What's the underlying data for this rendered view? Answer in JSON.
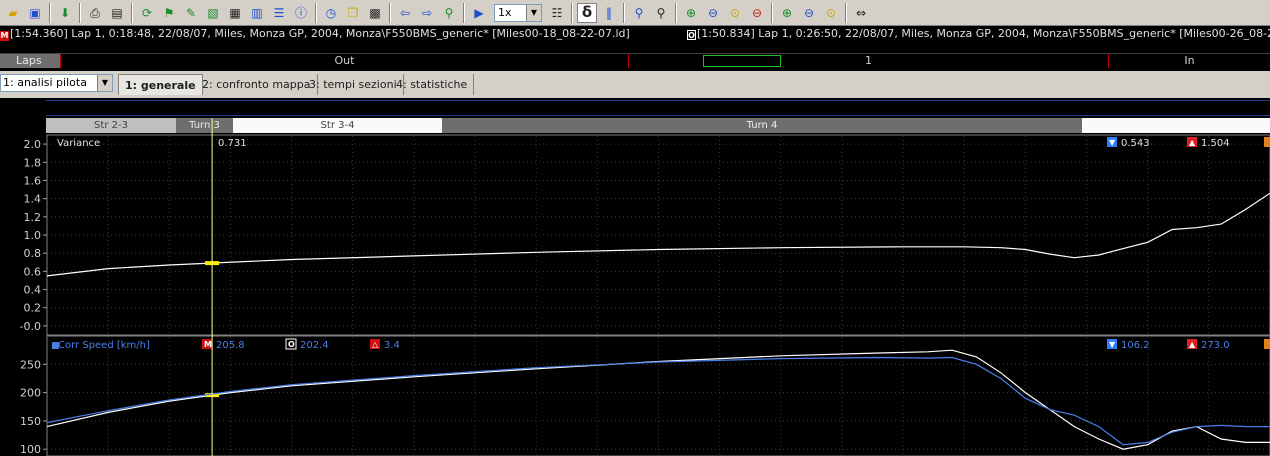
{
  "toolbar": {
    "icons": [
      "open-folder-icon",
      "save-icon",
      "download-arrow-icon",
      "print-icon",
      "print-preview-icon",
      "refresh-icon",
      "checkered-flag-icon",
      "edit-icon",
      "export-icon",
      "film-icon",
      "calculator-icon",
      "list-icon",
      "info-icon",
      "clock-icon",
      "windows-icon",
      "grid-icon",
      "back-arrow-icon",
      "forward-arrow-icon",
      "marker-icon",
      "play-icon"
    ],
    "speed_value": "1x",
    "delta_label": "δ",
    "zoom_icons": [
      "magnify-icon",
      "magnify-dark-icon",
      "zoom-in-icon",
      "zoom-out-icon",
      "zoom-yellow-icon",
      "zoom-red-icon",
      "zoom-in-plus-icon",
      "zoom-out-minus-icon",
      "zoom-fit-icon",
      "sync-cursor-icon"
    ]
  },
  "laps": {
    "lap_a": {
      "marker": "M",
      "text": "[1:54.360] Lap 1, 0:18:48, 22/08/07, Miles, Monza GP, 2004, Monza\\F550BMS_generic* [Miles00-18_08-22-07.ld]"
    },
    "lap_b": {
      "marker": "O",
      "text": "[1:50.834] Lap 1, 0:26:50, 22/08/07, Miles, Monza GP, 2004, Monza\\F550BMS_generic* [Miles00-26_08-22-07.ld]"
    }
  },
  "lapsbar": {
    "label": "Laps",
    "segments": [
      {
        "label": "Out"
      },
      {
        "label": "1"
      },
      {
        "label": "In"
      }
    ]
  },
  "workbook": {
    "selected": "1: analisi pilota"
  },
  "tabs": [
    {
      "label": "1: generale",
      "active": true
    },
    {
      "label": "2: confronto mappa",
      "active": false
    },
    {
      "label": "3: tempi sezioni",
      "active": false
    },
    {
      "label": "4: statistiche",
      "active": false
    }
  ],
  "sections": [
    {
      "label": "Str 2-3"
    },
    {
      "label": "Turn 3"
    },
    {
      "label": "Str 3-4"
    },
    {
      "label": "Turn 4"
    }
  ],
  "chart_data": [
    {
      "type": "line",
      "channel": "Variance",
      "cursor_value": "0.731",
      "min_label": "0.543",
      "max_label": "1.504",
      "ylim": [
        -0.1,
        2.1
      ],
      "yticks": [
        "2.0",
        "1.8",
        "1.6",
        "1.4",
        "1.2",
        "1.0",
        "0.8",
        "0.6",
        "0.4",
        "0.2",
        "-0.0"
      ],
      "ytick_values": [
        2.0,
        1.8,
        1.6,
        1.4,
        1.2,
        1.0,
        0.8,
        0.6,
        0.4,
        0.2,
        0.0
      ],
      "x": [
        0,
        0.05,
        0.1,
        0.2,
        0.3,
        0.4,
        0.5,
        0.6,
        0.7,
        0.75,
        0.78,
        0.8,
        0.82,
        0.84,
        0.86,
        0.88,
        0.9,
        0.92,
        0.94,
        0.96,
        0.98,
        1.0
      ],
      "series": [
        {
          "color": "#ffffff",
          "values": [
            0.55,
            0.63,
            0.67,
            0.73,
            0.77,
            0.81,
            0.84,
            0.86,
            0.87,
            0.87,
            0.86,
            0.84,
            0.79,
            0.75,
            0.78,
            0.85,
            0.92,
            1.06,
            1.08,
            1.12,
            1.28,
            1.46
          ]
        }
      ],
      "grid": true,
      "cursor_x": 0.135
    },
    {
      "type": "line",
      "channel": "Corr Speed [km/h]",
      "marker_m_value": "205.8",
      "marker_o_value": "202.4",
      "delta_value": "3.4",
      "min_label": "106.2",
      "max_label": "273.0",
      "ylim": [
        88,
        300
      ],
      "yticks": [
        "250",
        "200",
        "150",
        "100"
      ],
      "ytick_values": [
        250,
        200,
        150,
        100
      ],
      "x": [
        0,
        0.05,
        0.1,
        0.15,
        0.2,
        0.3,
        0.4,
        0.5,
        0.6,
        0.68,
        0.72,
        0.74,
        0.76,
        0.78,
        0.8,
        0.82,
        0.84,
        0.86,
        0.88,
        0.9,
        0.92,
        0.94,
        0.96,
        0.98,
        1.0
      ],
      "series": [
        {
          "name": "M",
          "color": "#ffffff",
          "values": [
            140,
            165,
            185,
            200,
            212,
            228,
            242,
            255,
            265,
            270,
            272,
            275,
            263,
            235,
            200,
            170,
            140,
            118,
            100,
            108,
            132,
            140,
            118,
            112,
            112
          ]
        },
        {
          "name": "O",
          "color": "#4a7fe8",
          "values": [
            147,
            168,
            187,
            202,
            214,
            230,
            244,
            254,
            260,
            262,
            261,
            262,
            250,
            225,
            190,
            170,
            160,
            140,
            108,
            112,
            130,
            140,
            142,
            140,
            140
          ]
        }
      ],
      "grid": true,
      "cursor_x": 0.135
    }
  ]
}
